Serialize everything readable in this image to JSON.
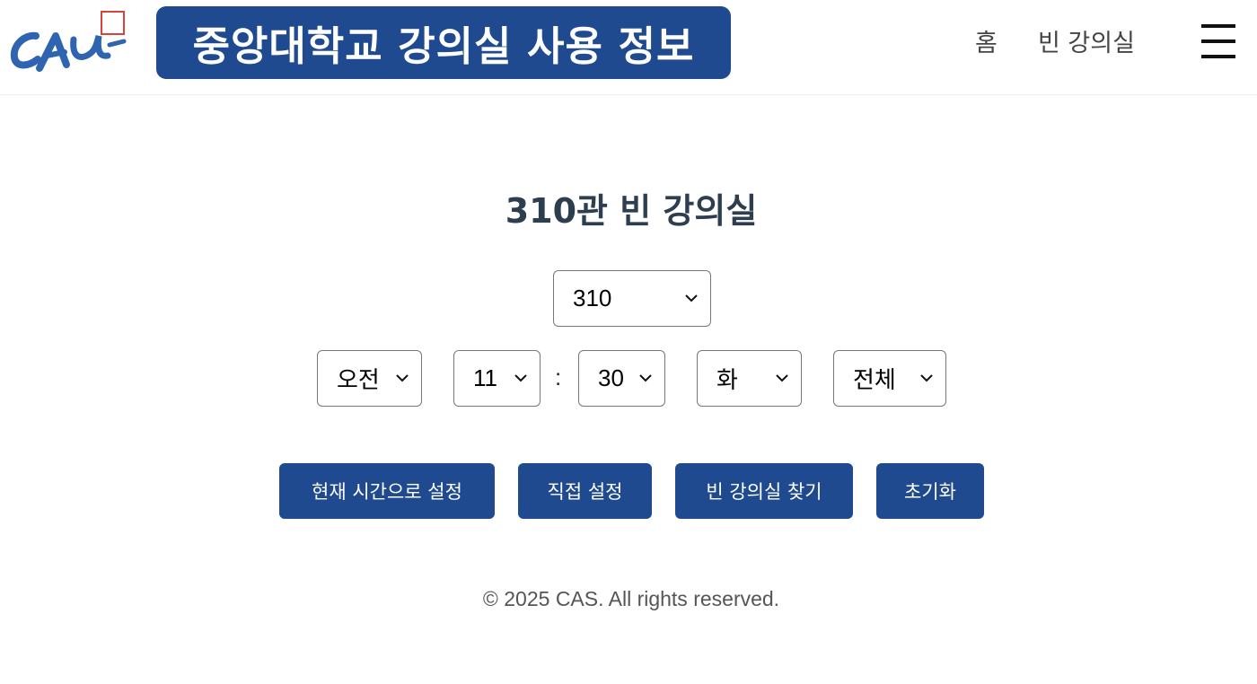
{
  "header": {
    "logo_text": "CAU",
    "site_title": "중앙대학교 강의실 사용 정보",
    "nav": [
      {
        "label": "홈"
      },
      {
        "label": "빈 강의실"
      }
    ],
    "menu_icon": "hamburger-menu-icon"
  },
  "main": {
    "title": "310관 빈 강의실",
    "building_select": {
      "value": "310"
    },
    "time_filters": {
      "ampm": "오전",
      "hour": "11",
      "separator": ":",
      "minute": "30",
      "day": "화",
      "range": "전체"
    },
    "buttons": [
      {
        "label": "현재 시간으로 설정"
      },
      {
        "label": "직접 설정"
      },
      {
        "label": "빈 강의실 찾기"
      },
      {
        "label": "초기화"
      }
    ]
  },
  "footer": {
    "copyright": "© 2025 CAS. All rights reserved."
  },
  "colors": {
    "primary": "#1f4a8f",
    "title_text": "#2c3e50",
    "logo_accent": "#d9443a"
  }
}
